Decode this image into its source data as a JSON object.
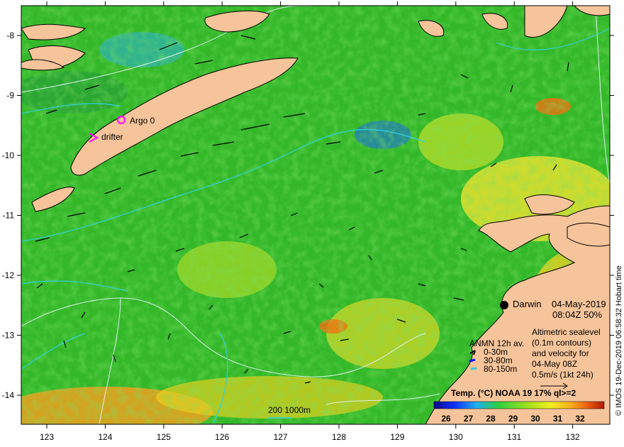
{
  "map": {
    "x_ticks": [
      "123",
      "124",
      "125",
      "126",
      "127",
      "128",
      "129",
      "130",
      "131",
      "132"
    ],
    "y_ticks": [
      "-8",
      "-9",
      "-10",
      "-11",
      "-12",
      "-13",
      "-14"
    ],
    "side_credit": "© IMOS 19-Dec-2019 06:58:32 Hobart time",
    "labels": {
      "argo": "Argo 0",
      "drifter": "drifter",
      "darwin": "Darwin",
      "date": "04-May-2019",
      "time_pct": "08:04Z  50%"
    },
    "legend_box": {
      "lines": [
        "Altimetric sealevel",
        "(0.1m contours)",
        "and velocity for",
        "04-May 08Z",
        "0.5m/s (1kt 24h)"
      ]
    },
    "anmn": {
      "title": "ANMN 12h av.",
      "items": [
        {
          "label": "0-30m",
          "color": "#000000"
        },
        {
          "label": "30-80m",
          "color": "#1010ff"
        },
        {
          "label": "80-150m",
          "color": "#20d0e0"
        }
      ]
    },
    "scale": {
      "label": "200  1000m"
    },
    "colorbar": {
      "title": "Temp. (°C) NOAA 19 17% ql>=2",
      "ticks": [
        "26",
        "27",
        "28",
        "29",
        "30",
        "31",
        "32"
      ]
    },
    "colors": {
      "land": "#f6c49a",
      "ocean_green": "#3cbe28",
      "contour": "#e8f4ff",
      "isobath": "#30d0e0",
      "argo": "#ff00ff"
    }
  }
}
